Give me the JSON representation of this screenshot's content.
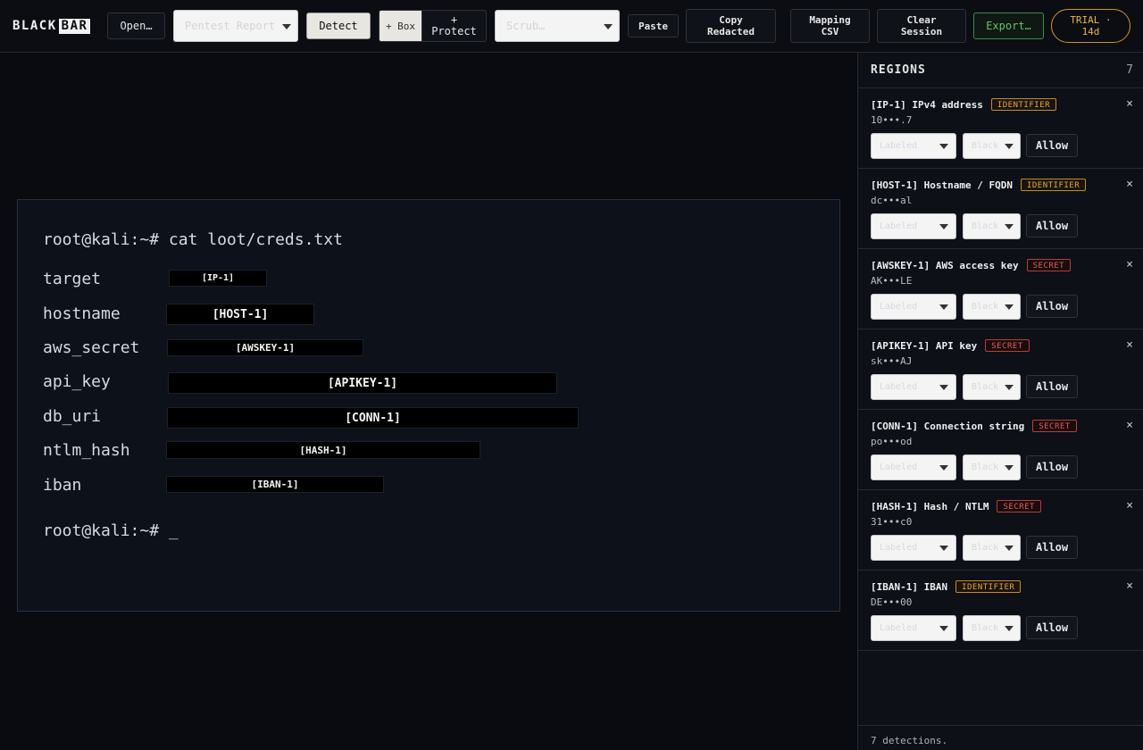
{
  "app": {
    "logo_black": "BLACK",
    "logo_bar": "BAR"
  },
  "toolbar": {
    "open_label": "Open…",
    "preset_placeholder": "Pentest Report",
    "detect_label": "Detect",
    "box_label": "+ Box",
    "protect_label": "+ Protect",
    "scrub_placeholder": "Scrub…",
    "paste_label": "Paste",
    "copy_redacted_label": "Copy Redacted",
    "mapping_csv_label": "Mapping CSV",
    "clear_session_label": "Clear Session",
    "export_label": "Export…",
    "trial_label": "TRIAL · 14d"
  },
  "terminal": {
    "command": "root@kali:~# cat loot/creds.txt",
    "prompt": "root@kali:~# _",
    "lines": [
      {
        "key": "target",
        "token": "[IP-1]"
      },
      {
        "key": "hostname",
        "token": "[HOST-1]"
      },
      {
        "key": "aws_secret",
        "token": "[AWSKEY-1]"
      },
      {
        "key": "api_key",
        "token": "[APIKEY-1]"
      },
      {
        "key": "db_uri",
        "token": "[CONN-1]"
      },
      {
        "key": "ntlm_hash",
        "token": "[HASH-1]"
      },
      {
        "key": "iban",
        "token": "[IBAN-1]"
      }
    ]
  },
  "sidebar": {
    "title": "REGIONS",
    "count": "7",
    "footer": "7 detections.",
    "style_placeholder": "Labeled",
    "fill_placeholder": "Black",
    "allow_label": "Allow",
    "close_glyph": "×",
    "regions": [
      {
        "title": "[IP-1] IPv4 address",
        "badge": "IDENTIFIER",
        "kind": "identifier",
        "mask": "10•••.7"
      },
      {
        "title": "[HOST-1] Hostname / FQDN",
        "badge": "IDENTIFIER",
        "kind": "identifier",
        "mask": "dc•••al"
      },
      {
        "title": "[AWSKEY-1] AWS access key",
        "badge": "SECRET",
        "kind": "secret",
        "mask": "AK•••LE"
      },
      {
        "title": "[APIKEY-1] API key",
        "badge": "SECRET",
        "kind": "secret",
        "mask": "sk•••AJ"
      },
      {
        "title": "[CONN-1] Connection string",
        "badge": "SECRET",
        "kind": "secret",
        "mask": "po•••od"
      },
      {
        "title": "[HASH-1] Hash / NTLM",
        "badge": "SECRET",
        "kind": "secret",
        "mask": "31•••c0"
      },
      {
        "title": "[IBAN-1] IBAN",
        "badge": "IDENTIFIER",
        "kind": "identifier",
        "mask": "DE•••00"
      }
    ]
  },
  "colors": {
    "accent_green": "#5cc56b",
    "trial_amber": "#e7b64a",
    "identifier": "#e7a93c",
    "secret": "#e85a5a"
  }
}
